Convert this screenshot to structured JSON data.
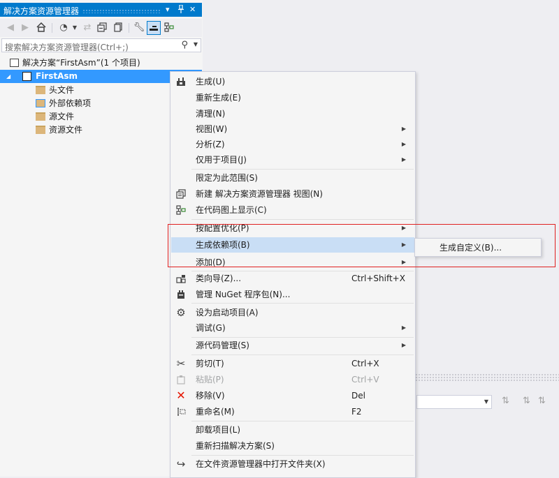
{
  "panel": {
    "title": "解决方案资源管理器",
    "title_buttons": [
      "▾",
      "ᚔ",
      "✕"
    ]
  },
  "search": {
    "placeholder": "搜索解决方案资源管理器(Ctrl+;)"
  },
  "tree": {
    "solution": "解决方案“FirstAsm”(1 个项目)",
    "project": "FirstAsm",
    "children": [
      "头文件",
      "外部依赖项",
      "源文件",
      "资源文件"
    ]
  },
  "context_menu": {
    "items": [
      {
        "label": "生成(U)",
        "shortcut": "",
        "icon": "build-icon"
      },
      {
        "label": "重新生成(E)",
        "shortcut": ""
      },
      {
        "label": "清理(N)",
        "shortcut": ""
      },
      {
        "label": "视图(W)",
        "shortcut": "",
        "submenu": true
      },
      {
        "label": "分析(Z)",
        "shortcut": "",
        "submenu": true
      },
      {
        "label": "仅用于项目(J)",
        "shortcut": "",
        "submenu": true
      },
      {
        "label": "限定为此范围(S)",
        "shortcut": ""
      },
      {
        "label": "新建 解决方案资源管理器 视图(N)",
        "shortcut": "",
        "icon": "new-view-icon"
      },
      {
        "label": "在代码图上显示(C)",
        "shortcut": "",
        "icon": "code-map-icon"
      },
      {
        "label": "按配置优化(P)",
        "shortcut": "",
        "submenu": true
      },
      {
        "label": "生成依赖项(B)",
        "shortcut": "",
        "submenu": true,
        "highlighted": true
      },
      {
        "label": "添加(D)",
        "shortcut": "",
        "submenu": true
      },
      {
        "label": "类向导(Z)...",
        "shortcut": "Ctrl+Shift+X",
        "icon": "class-wizard-icon"
      },
      {
        "label": "管理 NuGet 程序包(N)...",
        "shortcut": "",
        "icon": "nuget-icon"
      },
      {
        "label": "设为启动项目(A)",
        "shortcut": "",
        "icon": "gear-icon"
      },
      {
        "label": "调试(G)",
        "shortcut": "",
        "submenu": true
      },
      {
        "label": "源代码管理(S)",
        "shortcut": "",
        "submenu": true
      },
      {
        "label": "剪切(T)",
        "shortcut": "Ctrl+X",
        "icon": "scissors-icon"
      },
      {
        "label": "粘贴(P)",
        "shortcut": "Ctrl+V",
        "icon": "paste-icon",
        "disabled": true
      },
      {
        "label": "移除(V)",
        "shortcut": "Del",
        "icon": "remove-icon"
      },
      {
        "label": "重命名(M)",
        "shortcut": "F2",
        "icon": "rename-icon"
      },
      {
        "label": "卸载项目(L)",
        "shortcut": ""
      },
      {
        "label": "重新扫描解决方案(S)",
        "shortcut": ""
      },
      {
        "label": "在文件资源管理器中打开文件夹(X)",
        "shortcut": "",
        "icon": "open-folder-icon"
      }
    ]
  },
  "submenu": {
    "item": "生成自定义(B)..."
  },
  "colors": {
    "title_bar": "#007acc",
    "selection": "#3399ff",
    "menu_highlight": "#c9def5",
    "annotation": "#e02020"
  }
}
